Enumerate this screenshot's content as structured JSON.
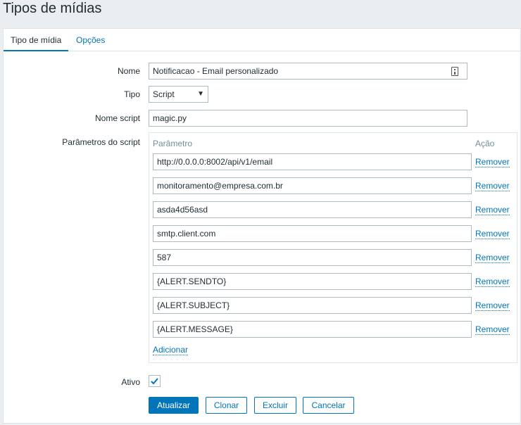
{
  "page": {
    "title": "Tipos de mídias"
  },
  "tabs": [
    {
      "label": "Tipo de mídia",
      "active": true
    },
    {
      "label": "Opções",
      "active": false
    }
  ],
  "form": {
    "name_label": "Nome",
    "name_value": "Notificacao - Email personalizado",
    "type_label": "Tipo",
    "type_value": "Script",
    "script_label": "Nome script",
    "script_value": "magic.py",
    "params_label": "Parâmetros do script",
    "params_header_param": "Parâmetro",
    "params_header_action": "Ação",
    "params": [
      {
        "value": "http://0.0.0.0:8002/api/v1/email",
        "action": "Remover"
      },
      {
        "value": "monitoramento@empresa.com.br",
        "action": "Remover"
      },
      {
        "value": "asda4d56asd",
        "action": "Remover"
      },
      {
        "value": "smtp.client.com",
        "action": "Remover"
      },
      {
        "value": "587",
        "action": "Remover"
      },
      {
        "value": "{ALERT.SENDTO}",
        "action": "Remover"
      },
      {
        "value": "{ALERT.SUBJECT}",
        "action": "Remover"
      },
      {
        "value": "{ALERT.MESSAGE}",
        "action": "Remover"
      }
    ],
    "add_label": "Adicionar",
    "active_label": "Ativo",
    "active_checked": true
  },
  "buttons": {
    "update": "Atualizar",
    "clone": "Clonar",
    "delete": "Excluir",
    "cancel": "Cancelar"
  },
  "colors": {
    "accent": "#0275b8",
    "background": "#ebeef0"
  }
}
